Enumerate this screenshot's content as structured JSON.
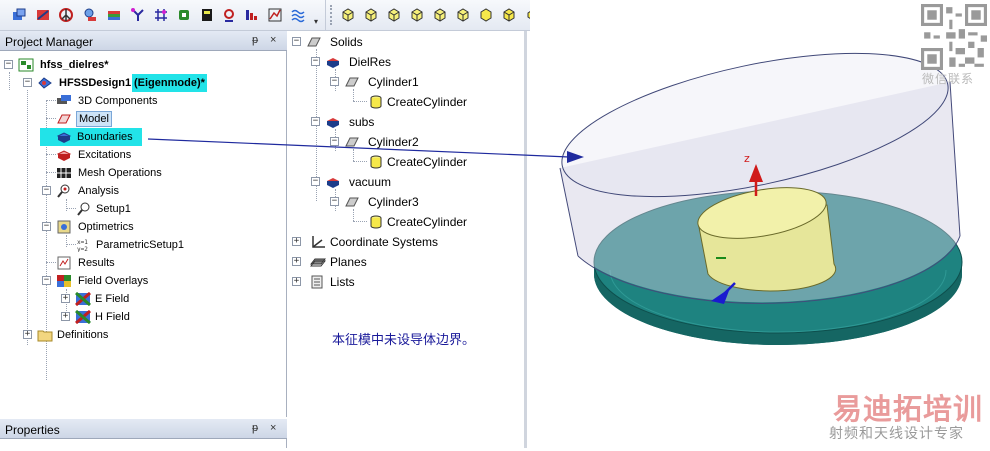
{
  "toolbar": {
    "left_icons": [
      "draw-box-icon",
      "draw-line-icon",
      "peace-icon",
      "zoom-icon",
      "flag-icon",
      "snap-icon",
      "snap-grid-icon",
      "node-icon",
      "calc-icon",
      "material-icon",
      "hfss-icon",
      "chart-icon",
      "field-icon",
      "more-icon"
    ],
    "right_icons": [
      "view-cube-1-icon",
      "view-cube-2-icon",
      "view-cube-3-icon",
      "view-cube-4-icon",
      "view-cube-5-icon",
      "view-cube-6-icon",
      "view-cube-7-icon",
      "view-cube-8-icon",
      "dropdown-icon"
    ]
  },
  "project_manager": {
    "title": "Project Manager",
    "pin": "ᵽ",
    "close": "×",
    "project": "hfss_dielres*",
    "design": "HFSSDesign1",
    "design_mode": "(Eigenmode)*",
    "items": {
      "components": "3D Components",
      "model": "Model",
      "boundaries": "Boundaries",
      "excitations": "Excitations",
      "mesh": "Mesh Operations",
      "analysis": "Analysis",
      "setup": "Setup1",
      "optimetrics": "Optimetrics",
      "parametric": "ParametricSetup1",
      "results": "Results",
      "field_overlays": "Field Overlays",
      "e_field": "E Field",
      "h_field": "H Field",
      "definitions": "Definitions"
    }
  },
  "properties": {
    "title": "Properties",
    "pin": "ᵽ",
    "close": "×"
  },
  "model_tree": {
    "solids": "Solids",
    "dielres": "DielRes",
    "cylinder1": "Cylinder1",
    "create1": "CreateCylinder",
    "subs": "subs",
    "cylinder2": "Cylinder2",
    "create2": "CreateCylinder",
    "vacuum": "vacuum",
    "cylinder3": "Cylinder3",
    "create3": "CreateCylinder",
    "coord": "Coordinate Systems",
    "planes": "Planes",
    "lists": "Lists"
  },
  "annotation": "本征模中未设导体边界。",
  "view": {
    "axis_z": "z"
  },
  "watermark": {
    "wechat": "微信联系",
    "logo": "易迪拓培训",
    "tagline": "射频和天线设计专家"
  },
  "colors": {
    "highlight_cyan": "#22e3e8",
    "annotation_arrow": "#1f2a9e",
    "substrate": "#1e7a77",
    "dielectric": "#e6e89a",
    "vacuum": "#d9d9e8"
  }
}
